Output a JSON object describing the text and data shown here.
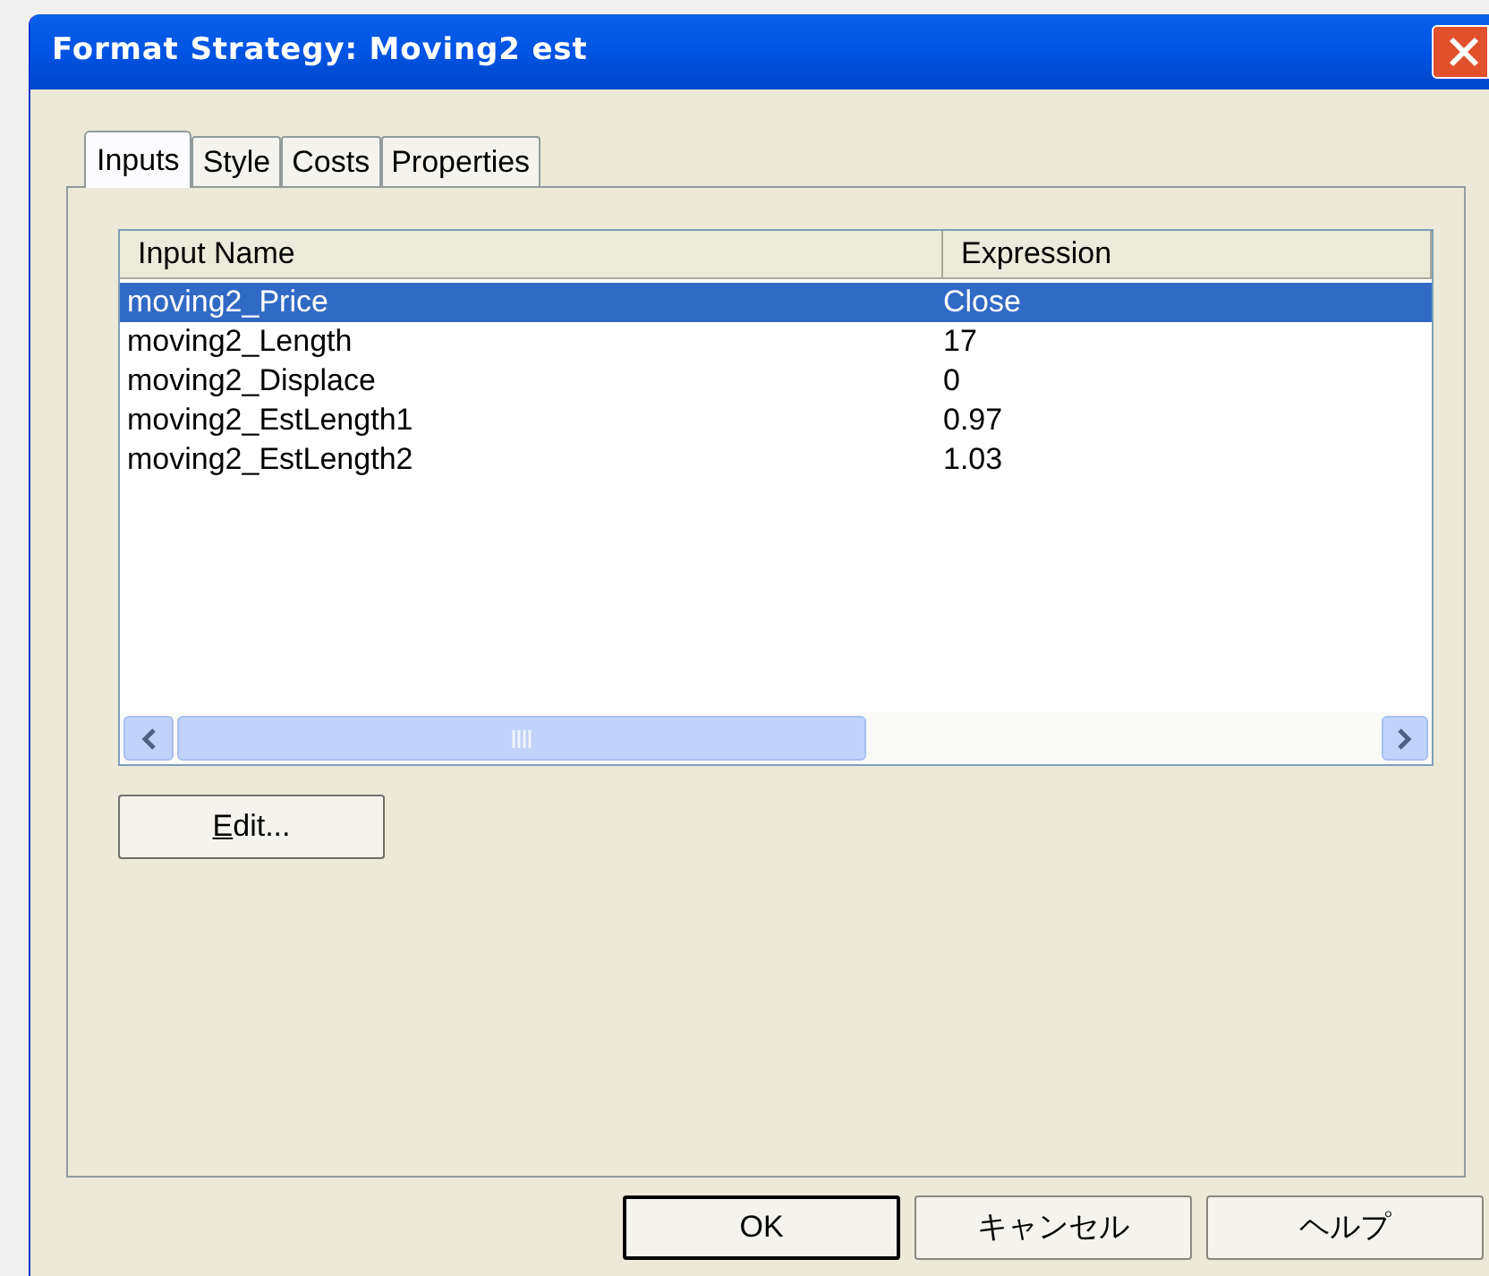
{
  "window": {
    "title": "Format Strategy: Moving2 est"
  },
  "tabs": [
    {
      "label": "Inputs",
      "selected": true
    },
    {
      "label": "Style",
      "selected": false
    },
    {
      "label": "Costs",
      "selected": false
    },
    {
      "label": "Properties",
      "selected": false
    }
  ],
  "table": {
    "columns": [
      "Input Name",
      "Expression"
    ],
    "rows": [
      {
        "cells": [
          "moving2_Price",
          "Close"
        ],
        "selected": true
      },
      {
        "cells": [
          "moving2_Length",
          "17"
        ],
        "selected": false
      },
      {
        "cells": [
          "moving2_Displace",
          "0"
        ],
        "selected": false
      },
      {
        "cells": [
          "moving2_EstLength1",
          "0.97"
        ],
        "selected": false
      },
      {
        "cells": [
          "moving2_EstLength2",
          "1.03"
        ],
        "selected": false
      }
    ]
  },
  "edit_button": {
    "label": "Edit...",
    "mnemonic_underlined": true
  },
  "buttons": [
    {
      "label": "OK",
      "default": true
    },
    {
      "label": "キャンセル",
      "default": false
    },
    {
      "label": "ヘルプ",
      "default": false
    }
  ]
}
